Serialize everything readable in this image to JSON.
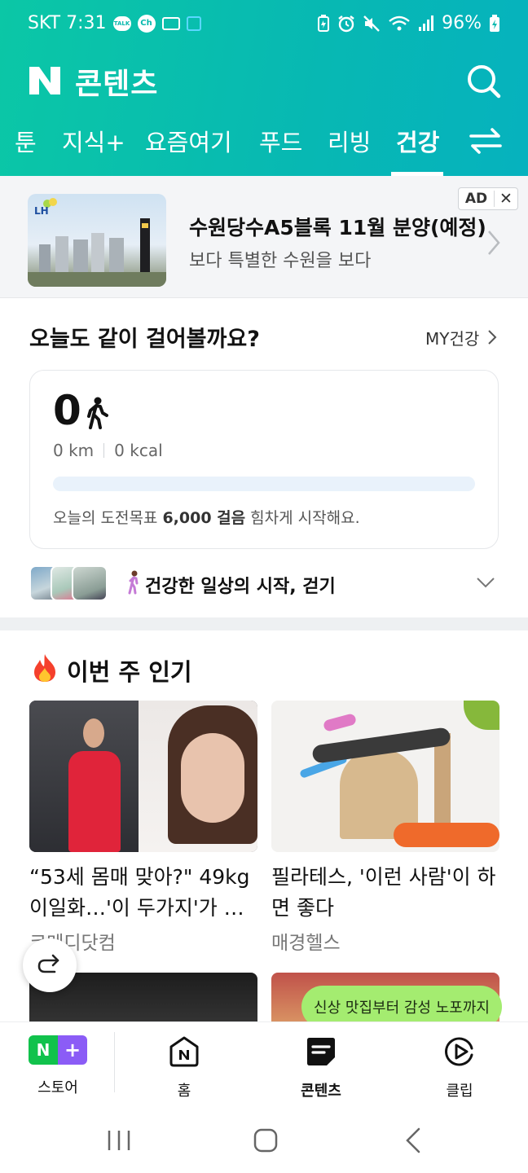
{
  "status_bar": {
    "carrier_time": "SKT 7:31",
    "talk_badge": "TALK",
    "ch_badge": "Ch",
    "battery": "96%"
  },
  "app": {
    "title": "콘텐츠",
    "logo_letter": "N"
  },
  "tabs": [
    {
      "label": "툰",
      "active": false
    },
    {
      "label": "지식+",
      "active": false
    },
    {
      "label": "요즘여기",
      "active": false
    },
    {
      "label": "푸드",
      "active": false
    },
    {
      "label": "리빙",
      "active": false
    },
    {
      "label": "건강",
      "active": true
    }
  ],
  "ad": {
    "title": "수원당수A5블록 11월 분양(예정)",
    "subtitle": "보다 특별한 수원을 보다",
    "badge": "AD",
    "close": "✕",
    "brand": "LH"
  },
  "walking": {
    "title": "오늘도 같이 걸어볼까요?",
    "my_link": "MY건강",
    "steps": "0",
    "distance": "0 km",
    "calories": "0 kcal",
    "progress_fraction": 0,
    "goal_prefix": "오늘의 도전목표 ",
    "goal_value": "6,000 걸음",
    "goal_suffix": " 힘차게 시작해요.",
    "caption": "건강한 일상의 시작, 걷기"
  },
  "popular": {
    "title": "이번 주 인기",
    "cards": [
      {
        "title": "“53세 몸매 맞아?\" 49kg 이일화…'이 두가지'가 …",
        "source": "코메디닷컴"
      },
      {
        "title": "필라테스, '이런 사람'이 하면 좋다",
        "source": "매경헬스"
      }
    ]
  },
  "tooltip": "신상 맛집부터 감성 노포까지",
  "bottom_nav": [
    {
      "label": "스토어",
      "active": false
    },
    {
      "label": "홈",
      "active": false
    },
    {
      "label": "콘텐츠",
      "active": true
    },
    {
      "label": "클립",
      "active": false
    }
  ],
  "store_icon": {
    "left": "N",
    "right": "+"
  },
  "colors": {
    "brand_gradient_start": "#0bc7a6",
    "brand_gradient_end": "#06b2be",
    "progress_track": "#e9f2fb",
    "tooltip_bg": "#a4ec70"
  }
}
